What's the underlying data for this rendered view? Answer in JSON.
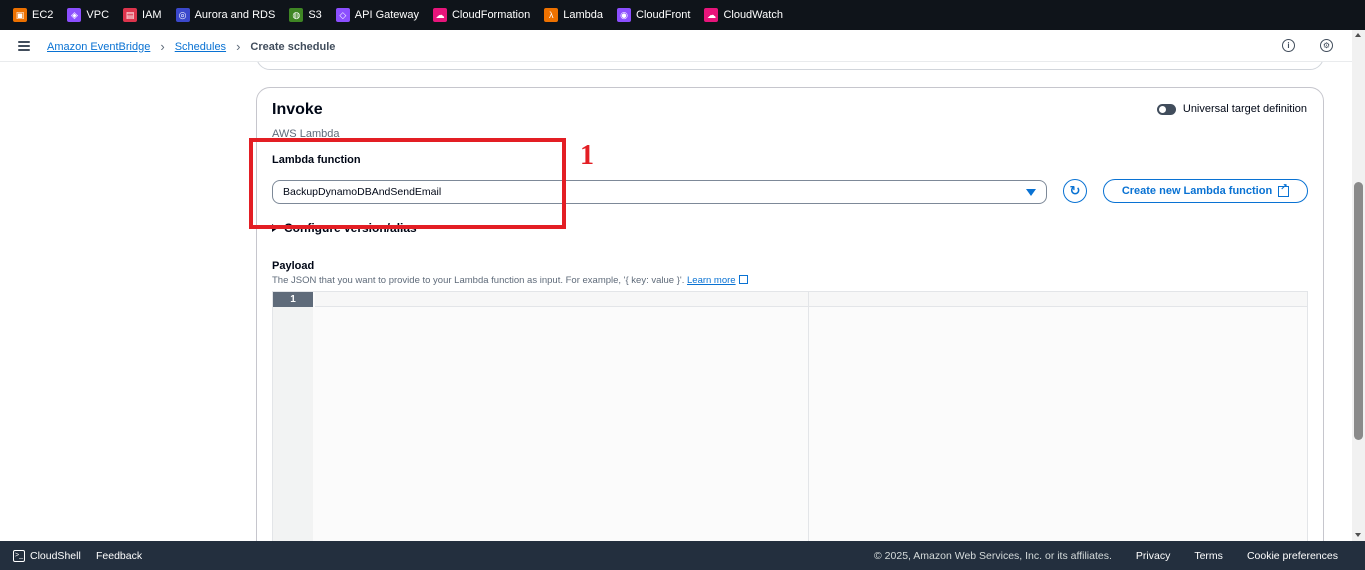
{
  "favorites": [
    {
      "label": "EC2",
      "icon": "ec2-icon",
      "color": "#ed7100"
    },
    {
      "label": "VPC",
      "icon": "vpc-icon",
      "color": "#8c4fff"
    },
    {
      "label": "IAM",
      "icon": "iam-icon",
      "color": "#dd344c"
    },
    {
      "label": "Aurora and RDS",
      "icon": "rds-icon",
      "color": "#3b48cc"
    },
    {
      "label": "S3",
      "icon": "s3-icon",
      "color": "#3f8624"
    },
    {
      "label": "API Gateway",
      "icon": "api-gateway-icon",
      "color": "#8c4fff"
    },
    {
      "label": "CloudFormation",
      "icon": "cloudformation-icon",
      "color": "#e7157b"
    },
    {
      "label": "Lambda",
      "icon": "lambda-icon",
      "color": "#ed7100"
    },
    {
      "label": "CloudFront",
      "icon": "cloudfront-icon",
      "color": "#8c4fff"
    },
    {
      "label": "CloudWatch",
      "icon": "cloudwatch-icon",
      "color": "#e7157b"
    }
  ],
  "breadcrumb": {
    "items": [
      "Amazon EventBridge",
      "Schedules"
    ],
    "current": "Create schedule"
  },
  "invoke": {
    "title": "Invoke",
    "subtitle": "AWS Lambda",
    "toggle_label": "Universal target definition",
    "lambda_label": "Lambda function",
    "lambda_value": "BackupDynamoDBAndSendEmail",
    "create_button": "Create new Lambda function",
    "expander_label": "Configure version/alias",
    "payload_label": "Payload",
    "payload_desc": "The JSON that you want to provide to your Lambda function as input. For example, '{ key: value }'.",
    "learn_more": "Learn more",
    "editor_line": "1"
  },
  "annotation": {
    "number": "1",
    "color": "#e31e24"
  },
  "footer": {
    "cloudshell": "CloudShell",
    "feedback": "Feedback",
    "copyright": "© 2025, Amazon Web Services, Inc. or its affiliates.",
    "privacy": "Privacy",
    "terms": "Terms",
    "cookies": "Cookie preferences"
  }
}
